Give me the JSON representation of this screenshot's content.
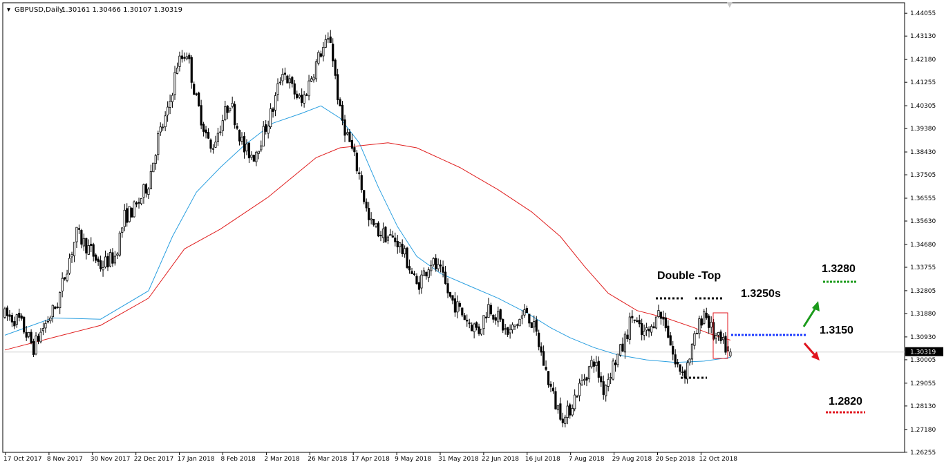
{
  "header": {
    "symbol": "GBPUSD,Daily",
    "ohlc": "1.30161 1.30466 1.30107 1.30319"
  },
  "colors": {
    "bull_candle": "#000000",
    "bear_candle": "#000000",
    "ma_fast": "#2a9fe0",
    "ma_slow": "#e01e1e",
    "current_price": "#cfcfcf",
    "price_label_bg": "#000000",
    "up_arrow": "#1a9a1a",
    "down_arrow": "#e0141e",
    "level_blue": "#1e3cff",
    "level_green": "#1a9a1a",
    "level_red": "#e0141e",
    "marker_box": "#e0141e"
  },
  "chart_data": {
    "type": "candlestick",
    "symbol": "GBPUSD",
    "timeframe": "Daily",
    "ylim": [
      1.2625,
      1.4448
    ],
    "y_ticks": [
      "1.44055",
      "1.43130",
      "1.42180",
      "1.41255",
      "1.40305",
      "1.39380",
      "1.38430",
      "1.37505",
      "1.36555",
      "1.35630",
      "1.34680",
      "1.33755",
      "1.32805",
      "1.31880",
      "1.30930",
      "1.30005",
      "1.29055",
      "1.28130",
      "1.27180",
      "1.26255"
    ],
    "x_ticks": [
      "17 Oct 2017",
      "8 Nov 2017",
      "30 Nov 2017",
      "22 Dec 2017",
      "17 Jan 2018",
      "8 Feb 2018",
      "2 Mar 2018",
      "26 Mar 2018",
      "17 Apr 2018",
      "9 May 2018",
      "31 May 2018",
      "22 Jun 2018",
      "16 Jul 2018",
      "7 Aug 2018",
      "29 Aug 2018",
      "20 Sep 2018",
      "12 Oct 2018"
    ],
    "current_price": "1.30319",
    "close_path": [
      [
        0,
        1.318
      ],
      [
        6,
        1.316
      ],
      [
        12,
        1.305
      ],
      [
        16,
        1.313
      ],
      [
        22,
        1.323
      ],
      [
        26,
        1.338
      ],
      [
        30,
        1.351
      ],
      [
        36,
        1.344
      ],
      [
        40,
        1.338
      ],
      [
        46,
        1.342
      ],
      [
        50,
        1.358
      ],
      [
        55,
        1.362
      ],
      [
        60,
        1.372
      ],
      [
        64,
        1.39
      ],
      [
        68,
        1.4
      ],
      [
        72,
        1.42
      ],
      [
        76,
        1.425
      ],
      [
        80,
        1.405
      ],
      [
        86,
        1.385
      ],
      [
        90,
        1.395
      ],
      [
        94,
        1.405
      ],
      [
        100,
        1.385
      ],
      [
        104,
        1.383
      ],
      [
        108,
        1.392
      ],
      [
        112,
        1.402
      ],
      [
        116,
        1.418
      ],
      [
        120,
        1.41
      ],
      [
        124,
        1.404
      ],
      [
        128,
        1.415
      ],
      [
        132,
        1.425
      ],
      [
        136,
        1.43
      ],
      [
        140,
        1.4
      ],
      [
        144,
        1.388
      ],
      [
        148,
        1.375
      ],
      [
        152,
        1.356
      ],
      [
        156,
        1.352
      ],
      [
        160,
        1.35
      ],
      [
        164,
        1.348
      ],
      [
        168,
        1.34
      ],
      [
        172,
        1.33
      ],
      [
        178,
        1.34
      ],
      [
        182,
        1.335
      ],
      [
        186,
        1.325
      ],
      [
        190,
        1.32
      ],
      [
        194,
        1.315
      ],
      [
        198,
        1.312
      ],
      [
        202,
        1.322
      ],
      [
        206,
        1.317
      ],
      [
        210,
        1.31
      ],
      [
        214,
        1.315
      ],
      [
        218,
        1.32
      ],
      [
        222,
        1.31
      ],
      [
        226,
        1.295
      ],
      [
        230,
        1.282
      ],
      [
        234,
        1.276
      ],
      [
        238,
        1.285
      ],
      [
        242,
        1.293
      ],
      [
        246,
        1.3
      ],
      [
        250,
        1.288
      ],
      [
        254,
        1.298
      ],
      [
        258,
        1.305
      ],
      [
        262,
        1.318
      ],
      [
        266,
        1.31
      ],
      [
        270,
        1.312
      ],
      [
        272,
        1.32
      ],
      [
        276,
        1.315
      ],
      [
        280,
        1.298
      ],
      [
        284,
        1.295
      ],
      [
        288,
        1.308
      ],
      [
        292,
        1.32
      ],
      [
        296,
        1.31
      ],
      [
        300,
        1.306
      ],
      [
        303,
        1.3032
      ]
    ],
    "series": [
      {
        "type": "ma",
        "color_key": "ma_fast",
        "points": [
          [
            0,
            1.31
          ],
          [
            20,
            1.317
          ],
          [
            40,
            1.3165
          ],
          [
            60,
            1.328
          ],
          [
            70,
            1.35
          ],
          [
            80,
            1.368
          ],
          [
            90,
            1.378
          ],
          [
            100,
            1.387
          ],
          [
            112,
            1.396
          ],
          [
            124,
            1.4
          ],
          [
            132,
            1.403
          ],
          [
            140,
            1.398
          ],
          [
            148,
            1.388
          ],
          [
            156,
            1.37
          ],
          [
            164,
            1.354
          ],
          [
            172,
            1.342
          ],
          [
            182,
            1.335
          ],
          [
            194,
            1.33
          ],
          [
            206,
            1.325
          ],
          [
            218,
            1.319
          ],
          [
            228,
            1.313
          ],
          [
            236,
            1.309
          ],
          [
            246,
            1.305
          ],
          [
            256,
            1.302
          ],
          [
            268,
            1.3
          ],
          [
            280,
            1.299
          ],
          [
            292,
            1.2995
          ],
          [
            303,
            1.301
          ]
        ]
      },
      {
        "type": "ma",
        "color_key": "ma_slow",
        "points": [
          [
            0,
            1.304
          ],
          [
            20,
            1.309
          ],
          [
            40,
            1.314
          ],
          [
            60,
            1.325
          ],
          [
            75,
            1.345
          ],
          [
            90,
            1.353
          ],
          [
            110,
            1.366
          ],
          [
            130,
            1.382
          ],
          [
            140,
            1.386
          ],
          [
            160,
            1.388
          ],
          [
            172,
            1.386
          ],
          [
            190,
            1.378
          ],
          [
            206,
            1.369
          ],
          [
            220,
            1.36
          ],
          [
            232,
            1.35
          ],
          [
            242,
            1.338
          ],
          [
            252,
            1.327
          ],
          [
            264,
            1.32
          ],
          [
            276,
            1.317
          ],
          [
            288,
            1.313
          ],
          [
            296,
            1.31
          ],
          [
            303,
            1.308
          ]
        ]
      }
    ],
    "annotations": {
      "title": "Double -Top",
      "level_label": "1.3250s",
      "levels": [
        "1.3280",
        "1.3150",
        "1.2820"
      ]
    }
  }
}
